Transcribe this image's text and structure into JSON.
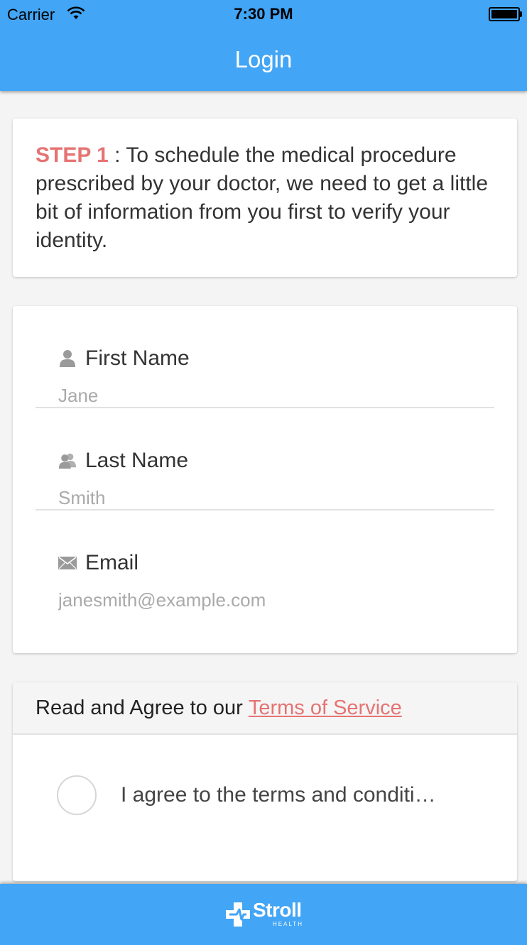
{
  "status_bar": {
    "carrier": "Carrier",
    "time": "7:30 PM"
  },
  "header": {
    "title": "Login"
  },
  "step_card": {
    "step_label": "STEP 1",
    "separator": " : ",
    "text": "To schedule the medical procedure prescribed by your doctor, we need to get a little bit of information from you first to verify your identity."
  },
  "form": {
    "first_name": {
      "label": "First Name",
      "placeholder": "Jane",
      "value": "",
      "icon": "person-icon"
    },
    "last_name": {
      "label": "Last Name",
      "placeholder": "Smith",
      "value": "",
      "icon": "people-icon"
    },
    "email": {
      "label": "Email",
      "placeholder": "janesmith@example.com",
      "value": "",
      "icon": "envelope-icon"
    }
  },
  "terms": {
    "prefix": "Read and Agree to our",
    "link_label": "Terms of Service",
    "checkbox_label": "I agree to the terms and conditi…",
    "checked": false
  },
  "footer": {
    "logo_name": "Stroll",
    "logo_sub": "HEALTH"
  },
  "colors": {
    "primary": "#42a5f5",
    "accent": "#e57373",
    "background": "#f4f4f4"
  }
}
